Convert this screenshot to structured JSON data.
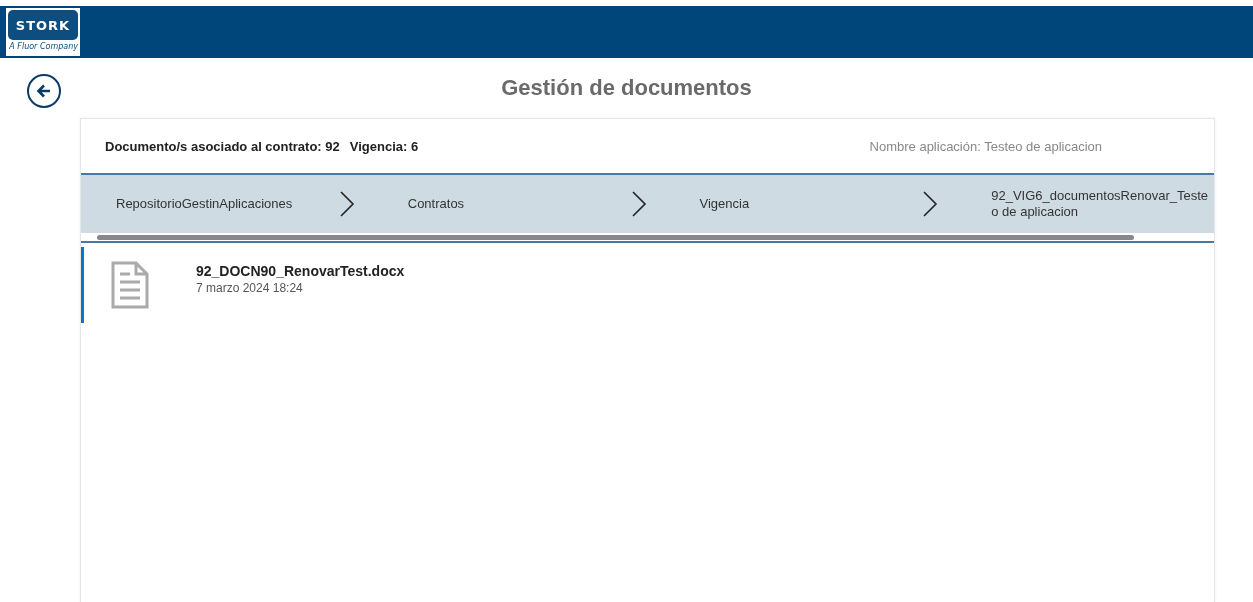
{
  "header": {
    "logo": {
      "name": "STORK",
      "tagline": "A Fluor Company"
    }
  },
  "page": {
    "title": "Gestión de documentos"
  },
  "info": {
    "contract": "Documento/s asociado al contrato: 92",
    "validity": "Vigencia: 6",
    "app_name": "Nombre aplicación: Testeo de aplicacion"
  },
  "breadcrumb": [
    {
      "label": "RepositorioGestinAplicaciones"
    },
    {
      "label": "Contratos"
    },
    {
      "label": "Vigencia"
    },
    {
      "label": "92_VIG6_documentosRenovar_Testeo de aplicacion"
    }
  ],
  "documents": [
    {
      "name": "92_DOCN90_RenovarTest.docx",
      "date": "7 marzo 2024 18:24",
      "selected": true
    }
  ]
}
